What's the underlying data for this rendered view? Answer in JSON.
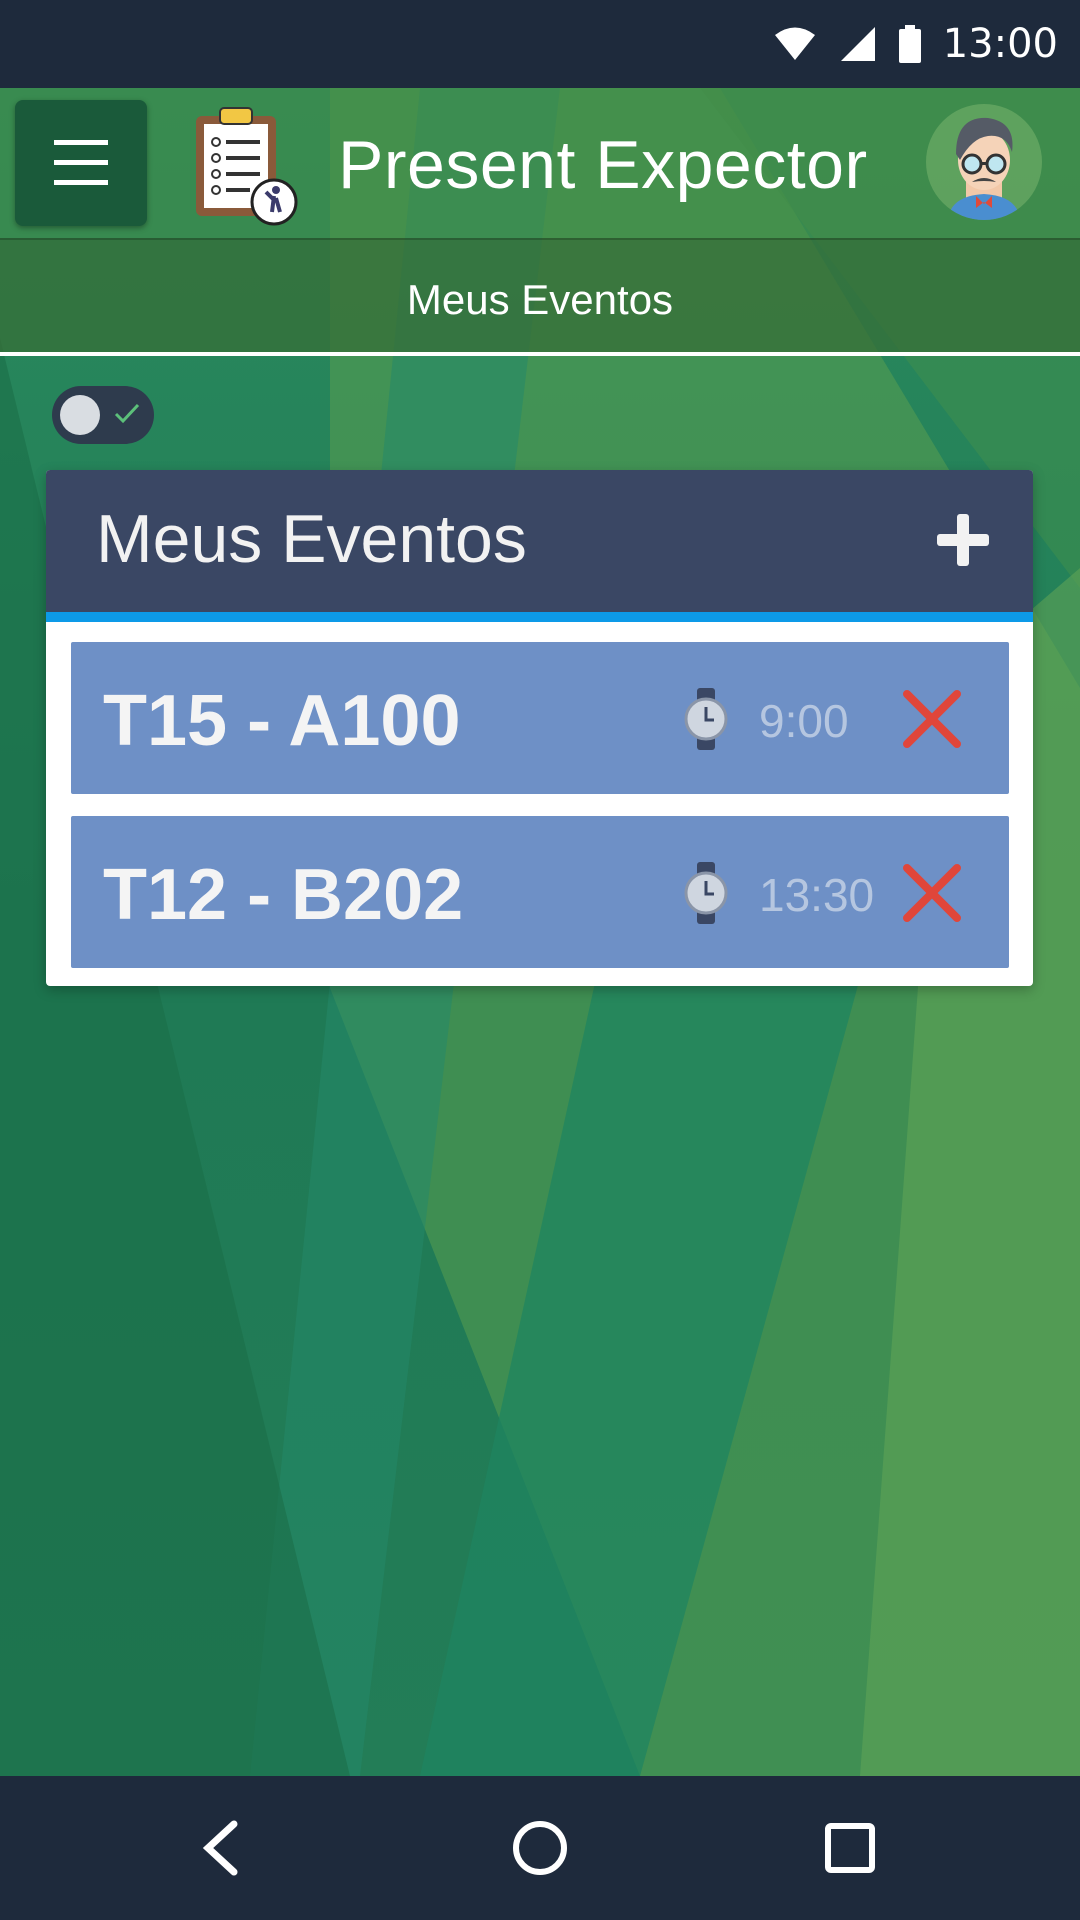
{
  "status_bar": {
    "time": "13:00",
    "icons": [
      "wifi-icon",
      "signal-icon",
      "battery-icon"
    ]
  },
  "header": {
    "title": "Present Expector",
    "menu_icon": "hamburger-menu-icon",
    "logo_icon": "clipboard-checklist-icon",
    "avatar_icon": "user-avatar-icon"
  },
  "tabs": [
    {
      "label": "Meus Eventos",
      "active": true
    }
  ],
  "toggle": {
    "state": "off"
  },
  "events_card": {
    "title": "Meus Eventos",
    "add_icon": "plus-icon",
    "items": [
      {
        "name": "T15 - A100",
        "time": "9:00",
        "time_icon": "watch-icon",
        "delete_icon": "close-x-icon"
      },
      {
        "name": "T12 - B202",
        "time": "13:30",
        "time_icon": "watch-icon",
        "delete_icon": "close-x-icon"
      }
    ]
  },
  "nav_bar": {
    "buttons": [
      "back-icon",
      "home-icon",
      "recent-apps-icon"
    ]
  },
  "colors": {
    "status_bar": "#1e2a3c",
    "card_header": "#3a4764",
    "card_accent": "#0d9ae8",
    "event_row": "#6e90c6",
    "delete": "#e0463a"
  }
}
